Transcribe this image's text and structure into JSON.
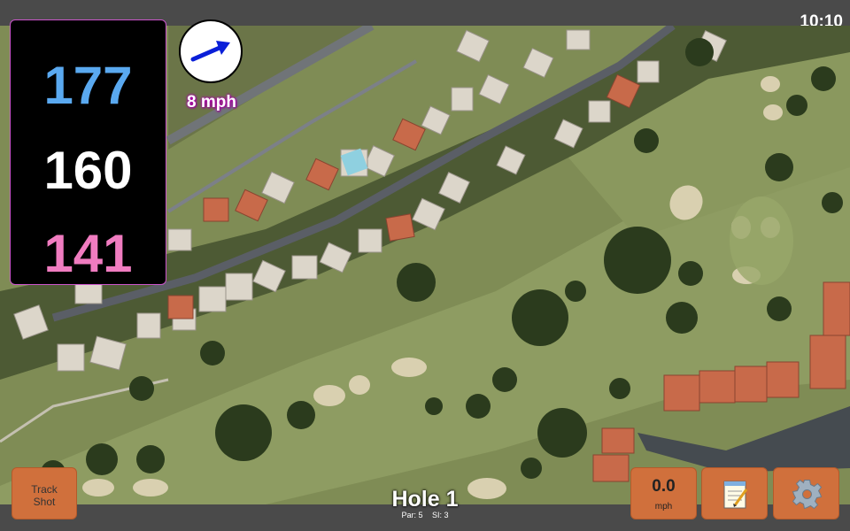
{
  "status": {
    "time": "10:10"
  },
  "yardage": {
    "back": "177",
    "middle": "160",
    "front": "141",
    "colors": {
      "back": "#5aa9f0",
      "middle": "#ffffff",
      "front": "#f07cc0",
      "border": "#cc55cc"
    }
  },
  "wind": {
    "speed_label": "8 mph",
    "arrow_icon": "wind-arrow-icon",
    "arrow_color": "#0a1fd8",
    "direction": "north-east"
  },
  "hole": {
    "title": "Hole 1",
    "par_label": "Par: 5",
    "si_label": "SI: 3"
  },
  "buttons": {
    "track_shot_line1": "Track",
    "track_shot_line2": "Shot",
    "speed_value": "0.0",
    "speed_unit": "mph",
    "notes_icon": "notepad-icon",
    "settings_icon": "gear-icon",
    "accent": "#d0703c"
  },
  "map": {
    "type": "satellite",
    "feature_colors": {
      "fairway": "#8a9a5a",
      "rough": "#6e7c48",
      "trees": "#2e3a1e",
      "roofs": "#d9d0c0",
      "road": "#555860",
      "bunker": "#d8cfae",
      "water": "#8fd0e0"
    }
  }
}
